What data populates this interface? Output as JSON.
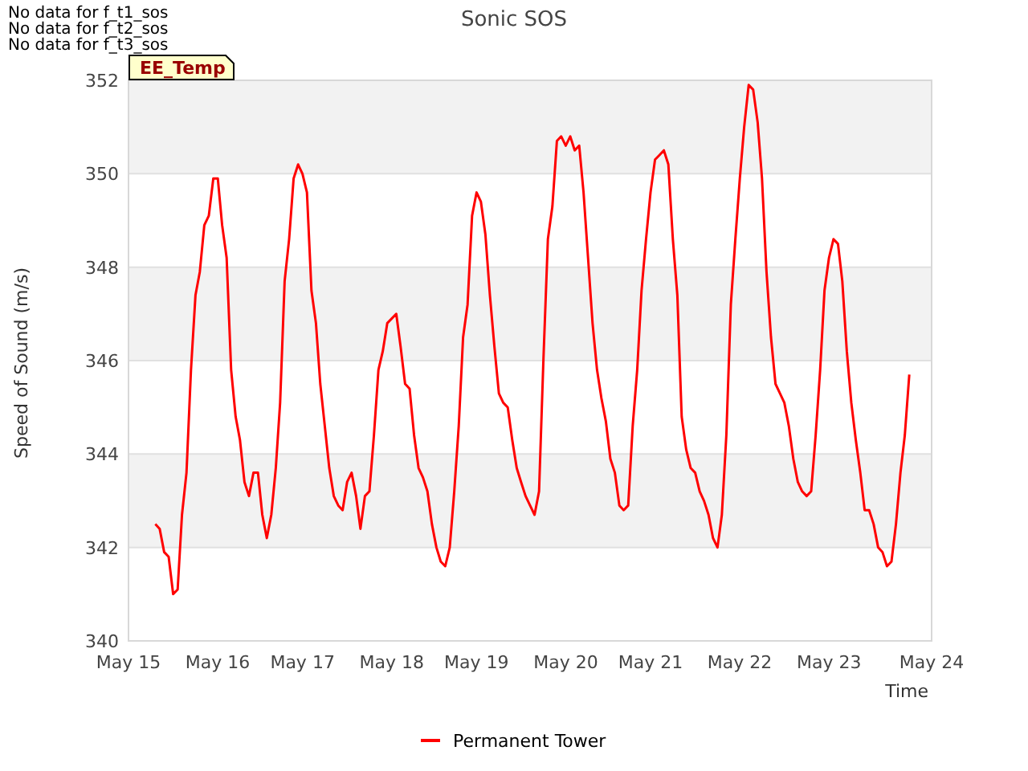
{
  "notices": [
    "No data for f_t1_sos",
    "No data for f_t2_sos",
    "No data for f_t3_sos"
  ],
  "badge": {
    "label": "EE_Temp"
  },
  "chart_data": {
    "type": "line",
    "title": "Sonic SOS",
    "xlabel": "Time",
    "ylabel": "Speed of Sound (m/s)",
    "grid": true,
    "ylim": [
      340,
      352
    ],
    "categories": [
      "May 15",
      null,
      null,
      null,
      null,
      null,
      null,
      null,
      null,
      null,
      null,
      null,
      null,
      null,
      null,
      null,
      null,
      null,
      null,
      null,
      "May 16",
      null,
      null,
      null,
      null,
      null,
      null,
      null,
      null,
      null,
      null,
      null,
      null,
      null,
      null,
      null,
      null,
      null,
      null,
      "May 17",
      null,
      null,
      null,
      null,
      null,
      null,
      null,
      null,
      null,
      null,
      null,
      null,
      null,
      null,
      null,
      null,
      null,
      null,
      null,
      "May 18",
      null,
      null,
      null,
      null,
      null,
      null,
      null,
      null,
      null,
      null,
      null,
      null,
      null,
      null,
      null,
      null,
      null,
      null,
      "May 19",
      null,
      null,
      null,
      null,
      null,
      null,
      null,
      null,
      null,
      null,
      null,
      null,
      null,
      null,
      null,
      null,
      null,
      null,
      null,
      "May 20",
      null,
      null,
      null,
      null,
      null,
      null,
      null,
      null,
      null,
      null,
      null,
      null,
      null,
      null,
      null,
      null,
      null,
      null,
      "May 21",
      null,
      null,
      null,
      null,
      null,
      null,
      null,
      null,
      null,
      null,
      null,
      null,
      null,
      null,
      null,
      null,
      null,
      null,
      null,
      "May 22",
      null,
      null,
      null,
      null,
      null,
      null,
      null,
      null,
      null,
      null,
      null,
      null,
      null,
      null,
      null,
      null,
      null,
      null,
      null,
      "May 23",
      null,
      null,
      null,
      null,
      null,
      null,
      null,
      null,
      null,
      null,
      null,
      null,
      null,
      null,
      null,
      null,
      null,
      null,
      null,
      null,
      null,
      null,
      "May 24"
    ],
    "yticks": [
      340,
      342,
      344,
      346,
      348,
      350,
      352
    ],
    "series": [
      {
        "name": "Permanent Tower",
        "color": "#ff0000",
        "values": [
          null,
          null,
          null,
          null,
          null,
          null,
          342.5,
          342.4,
          341.9,
          341.8,
          341.0,
          341.1,
          342.7,
          343.6,
          345.8,
          347.4,
          347.9,
          348.9,
          349.1,
          349.9,
          349.9,
          348.9,
          348.2,
          345.8,
          344.8,
          344.3,
          343.4,
          343.1,
          343.6,
          343.6,
          342.7,
          342.2,
          342.7,
          343.7,
          345.1,
          347.7,
          348.6,
          349.9,
          350.2,
          350.0,
          349.6,
          347.5,
          346.8,
          345.5,
          344.6,
          343.7,
          343.1,
          342.9,
          342.8,
          343.4,
          343.6,
          343.1,
          342.4,
          343.1,
          343.2,
          344.4,
          345.8,
          346.2,
          346.8,
          346.9,
          347.0,
          346.3,
          345.5,
          345.4,
          344.4,
          343.7,
          343.5,
          343.2,
          342.5,
          342.0,
          341.7,
          341.6,
          342.0,
          343.2,
          344.6,
          346.5,
          347.2,
          349.1,
          349.6,
          349.4,
          348.7,
          347.4,
          346.3,
          345.3,
          345.1,
          345.0,
          344.3,
          343.7,
          343.4,
          343.1,
          342.9,
          342.7,
          343.2,
          346.0,
          348.6,
          349.3,
          350.7,
          350.8,
          350.6,
          350.8,
          350.5,
          350.6,
          349.6,
          348.2,
          346.8,
          345.8,
          345.2,
          344.7,
          343.9,
          343.6,
          342.9,
          342.8,
          342.9,
          344.6,
          345.8,
          347.5,
          348.6,
          349.6,
          350.3,
          350.4,
          350.5,
          350.2,
          348.6,
          347.4,
          344.8,
          344.1,
          343.7,
          343.6,
          343.2,
          343.0,
          342.7,
          342.2,
          342.0,
          342.7,
          344.4,
          347.2,
          348.6,
          349.9,
          351.0,
          351.9,
          351.8,
          351.1,
          349.9,
          347.9,
          346.5,
          345.5,
          345.3,
          345.1,
          344.6,
          343.9,
          343.4,
          343.2,
          343.1,
          343.2,
          344.4,
          345.8,
          347.5,
          348.2,
          348.6,
          348.5,
          347.7,
          346.2,
          345.1,
          344.3,
          343.6,
          342.8,
          342.8,
          342.5,
          342.0,
          341.9,
          341.6,
          341.7,
          342.5,
          343.6,
          344.4,
          345.7,
          null,
          null,
          null,
          null,
          null
        ]
      }
    ]
  }
}
